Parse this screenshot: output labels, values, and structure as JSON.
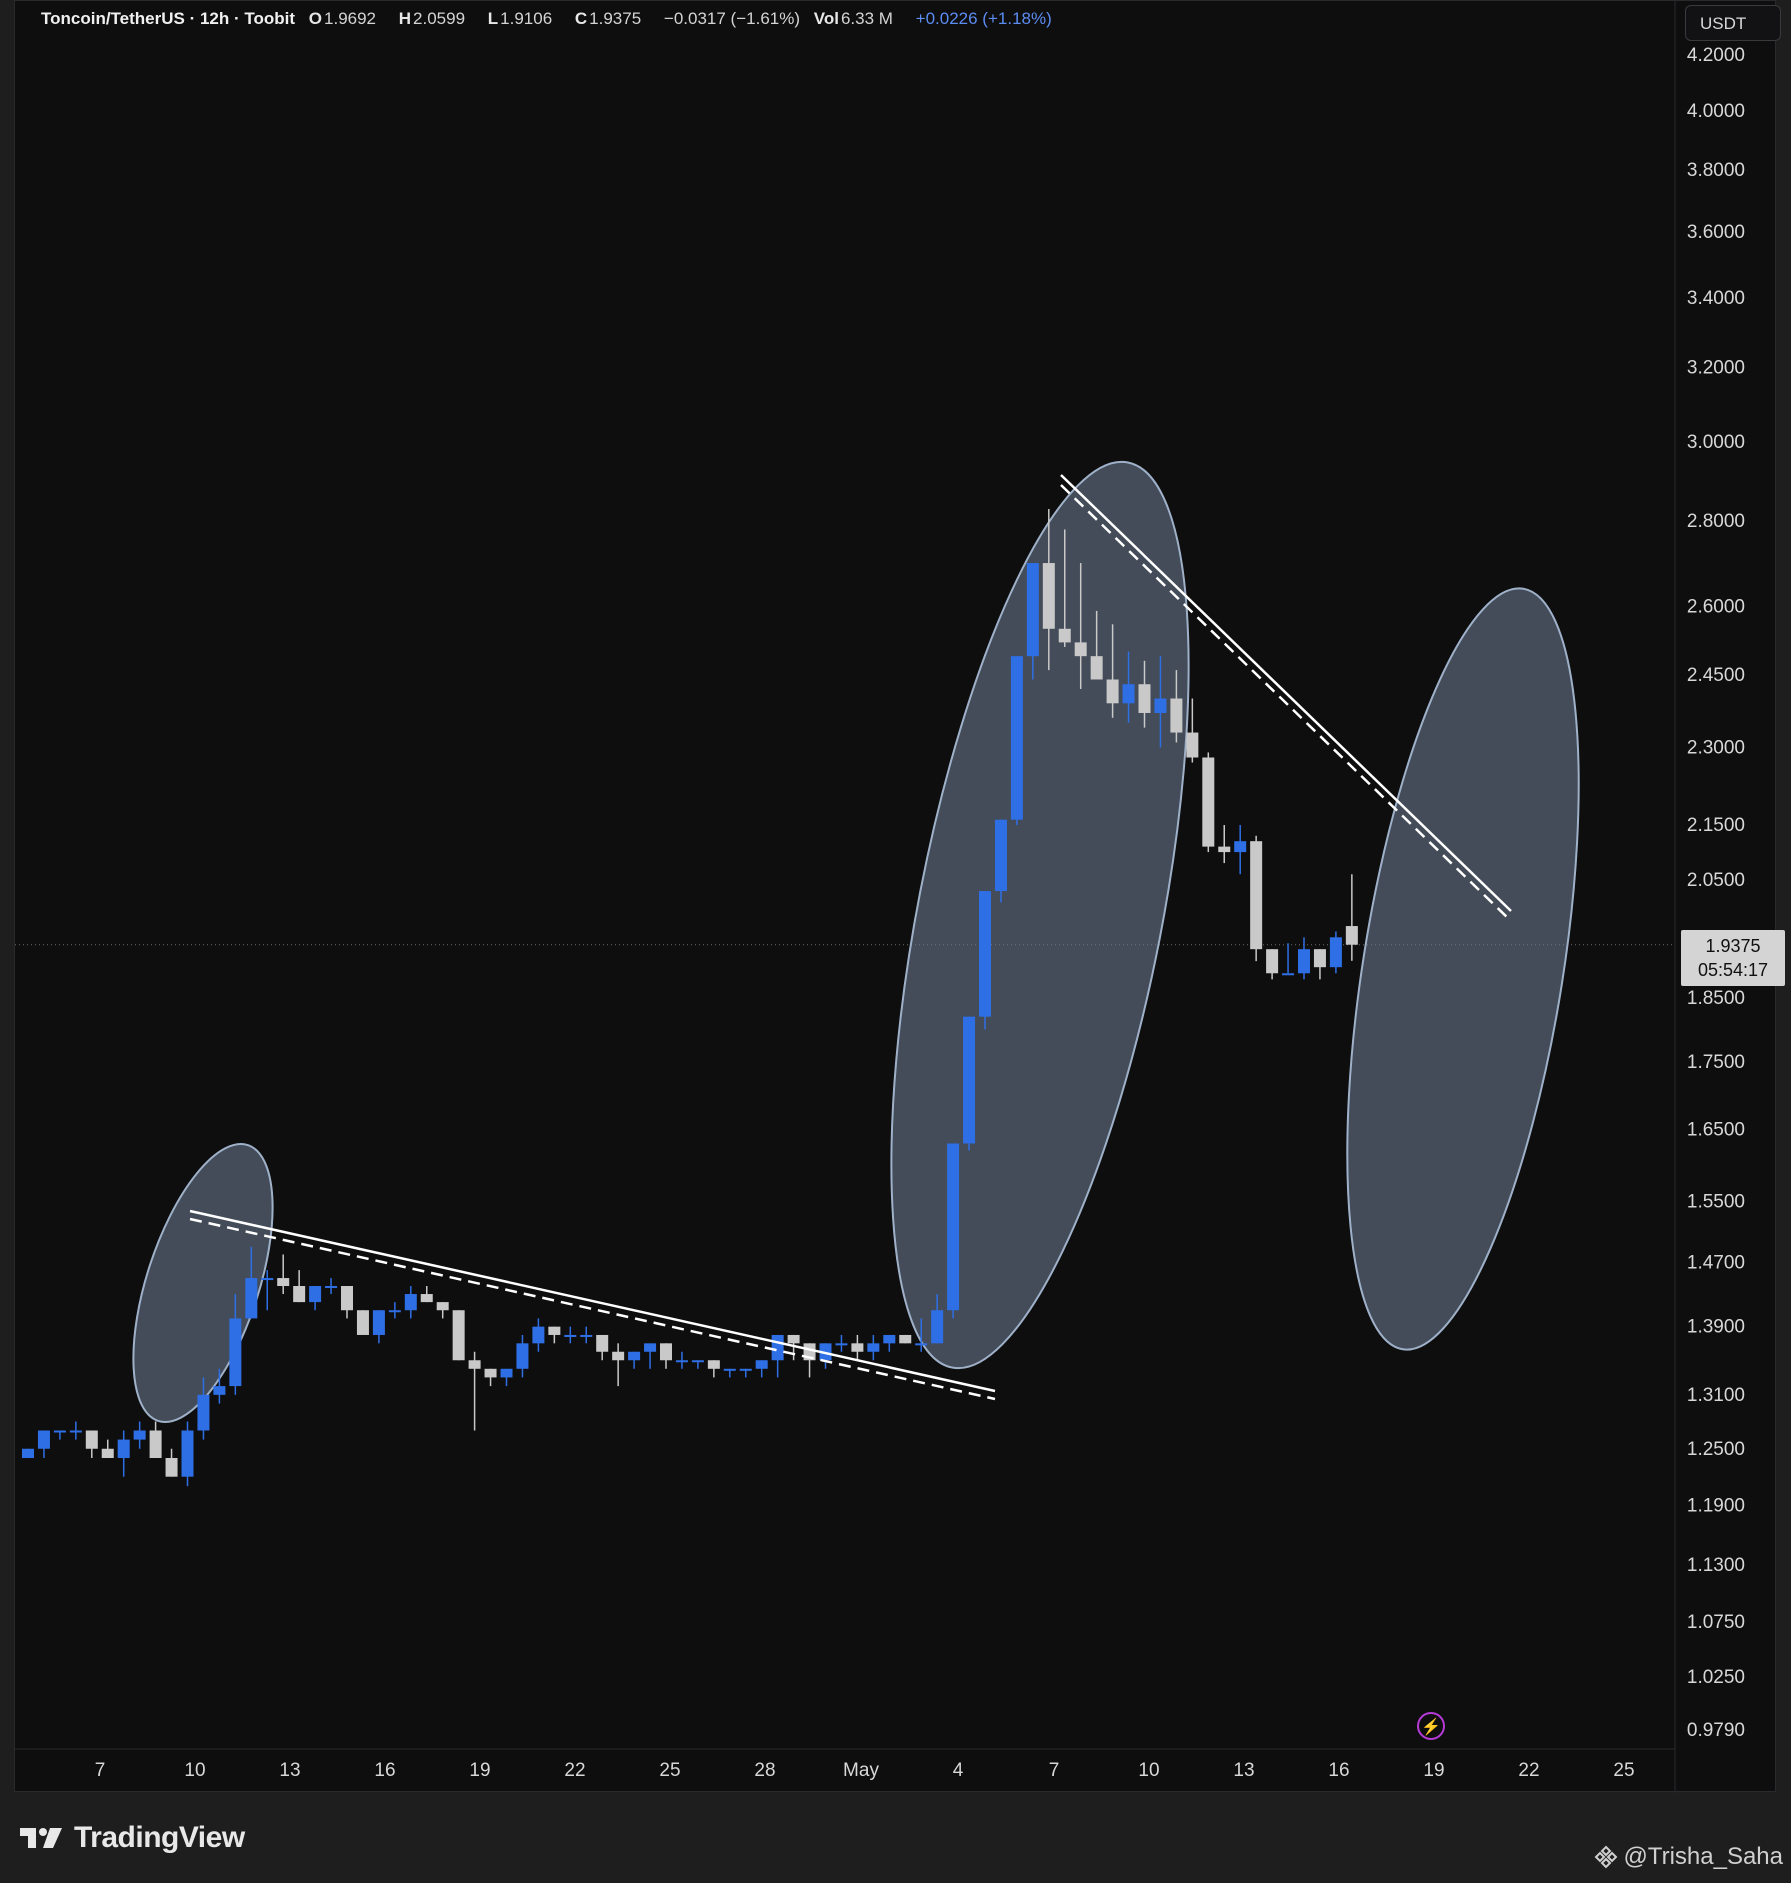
{
  "header": {
    "symbol": "Toncoin/TetherUS · 12h · Toobit",
    "open_key": "O",
    "open": "1.9692",
    "high_key": "H",
    "high": "2.0599",
    "low_key": "L",
    "low": "1.9106",
    "close_key": "C",
    "close": "1.9375",
    "change": "−0.0317 (−1.61%)",
    "vol_key": "Vol",
    "vol": "6.33 M",
    "vol_change": "+0.0226 (+1.18%)"
  },
  "currency": "USDT",
  "price_label": {
    "price": "1.9375",
    "countdown": "05:54:17"
  },
  "footer": {
    "brand": "TradingView",
    "credit": "@Trisha_Saha"
  },
  "colors": {
    "up": "#2f6fe6",
    "down": "#c9c9c9",
    "ellipse": "#6f7f96",
    "trendline": "#ffffff"
  },
  "chart_data": {
    "type": "candlestick",
    "scale": "log",
    "y_ticks": [
      "4.2000",
      "4.0000",
      "3.8000",
      "3.6000",
      "3.4000",
      "3.2000",
      "3.0000",
      "2.8000",
      "2.6000",
      "2.4500",
      "2.3000",
      "2.1500",
      "2.0500",
      "1.8500",
      "1.7500",
      "1.6500",
      "1.5500",
      "1.4700",
      "1.3900",
      "1.3100",
      "1.2500",
      "1.1900",
      "1.1300",
      "1.0750",
      "1.0250",
      "0.9790"
    ],
    "x_ticks": [
      "7",
      "10",
      "13",
      "16",
      "19",
      "22",
      "25",
      "28",
      "May",
      "4",
      "7",
      "10",
      "13",
      "16",
      "19",
      "22",
      "25"
    ],
    "candles": [
      [
        1.24,
        1.25,
        1.24,
        1.25
      ],
      [
        1.25,
        1.27,
        1.24,
        1.27
      ],
      [
        1.27,
        1.27,
        1.26,
        1.27
      ],
      [
        1.27,
        1.28,
        1.26,
        1.27
      ],
      [
        1.27,
        1.27,
        1.24,
        1.25
      ],
      [
        1.25,
        1.26,
        1.24,
        1.24
      ],
      [
        1.24,
        1.27,
        1.22,
        1.26
      ],
      [
        1.26,
        1.28,
        1.25,
        1.27
      ],
      [
        1.27,
        1.28,
        1.24,
        1.24
      ],
      [
        1.24,
        1.25,
        1.22,
        1.22
      ],
      [
        1.22,
        1.28,
        1.21,
        1.27
      ],
      [
        1.27,
        1.33,
        1.26,
        1.31
      ],
      [
        1.31,
        1.34,
        1.3,
        1.32
      ],
      [
        1.32,
        1.43,
        1.31,
        1.4
      ],
      [
        1.4,
        1.49,
        1.4,
        1.45
      ],
      [
        1.45,
        1.46,
        1.41,
        1.45
      ],
      [
        1.45,
        1.48,
        1.43,
        1.44
      ],
      [
        1.44,
        1.46,
        1.42,
        1.42
      ],
      [
        1.42,
        1.44,
        1.41,
        1.44
      ],
      [
        1.44,
        1.45,
        1.43,
        1.44
      ],
      [
        1.44,
        1.44,
        1.4,
        1.41
      ],
      [
        1.41,
        1.41,
        1.38,
        1.38
      ],
      [
        1.38,
        1.41,
        1.37,
        1.41
      ],
      [
        1.41,
        1.42,
        1.4,
        1.41
      ],
      [
        1.41,
        1.44,
        1.4,
        1.43
      ],
      [
        1.43,
        1.44,
        1.42,
        1.42
      ],
      [
        1.42,
        1.42,
        1.4,
        1.41
      ],
      [
        1.41,
        1.41,
        1.35,
        1.35
      ],
      [
        1.35,
        1.36,
        1.27,
        1.34
      ],
      [
        1.34,
        1.34,
        1.32,
        1.33
      ],
      [
        1.33,
        1.34,
        1.32,
        1.34
      ],
      [
        1.34,
        1.38,
        1.33,
        1.37
      ],
      [
        1.37,
        1.4,
        1.36,
        1.39
      ],
      [
        1.39,
        1.39,
        1.37,
        1.38
      ],
      [
        1.38,
        1.39,
        1.37,
        1.38
      ],
      [
        1.38,
        1.39,
        1.37,
        1.38
      ],
      [
        1.38,
        1.38,
        1.35,
        1.36
      ],
      [
        1.36,
        1.37,
        1.32,
        1.35
      ],
      [
        1.35,
        1.36,
        1.34,
        1.36
      ],
      [
        1.36,
        1.37,
        1.34,
        1.37
      ],
      [
        1.37,
        1.37,
        1.34,
        1.35
      ],
      [
        1.35,
        1.36,
        1.34,
        1.35
      ],
      [
        1.35,
        1.35,
        1.34,
        1.35
      ],
      [
        1.35,
        1.35,
        1.33,
        1.34
      ],
      [
        1.34,
        1.34,
        1.33,
        1.34
      ],
      [
        1.34,
        1.34,
        1.33,
        1.34
      ],
      [
        1.34,
        1.35,
        1.33,
        1.35
      ],
      [
        1.35,
        1.36,
        1.33,
        1.38
      ],
      [
        1.38,
        1.38,
        1.35,
        1.37
      ],
      [
        1.37,
        1.37,
        1.33,
        1.35
      ],
      [
        1.35,
        1.37,
        1.34,
        1.37
      ],
      [
        1.37,
        1.38,
        1.36,
        1.37
      ],
      [
        1.37,
        1.38,
        1.35,
        1.36
      ],
      [
        1.36,
        1.38,
        1.35,
        1.37
      ],
      [
        1.37,
        1.38,
        1.36,
        1.38
      ],
      [
        1.38,
        1.38,
        1.37,
        1.37
      ],
      [
        1.37,
        1.4,
        1.36,
        1.37
      ],
      [
        1.37,
        1.43,
        1.37,
        1.41
      ],
      [
        1.41,
        1.63,
        1.4,
        1.63
      ],
      [
        1.63,
        1.82,
        1.62,
        1.82
      ],
      [
        1.82,
        2.03,
        1.8,
        2.03
      ],
      [
        2.03,
        2.16,
        2.01,
        2.16
      ],
      [
        2.16,
        2.4,
        2.15,
        2.49
      ],
      [
        2.49,
        2.62,
        2.44,
        2.7
      ],
      [
        2.7,
        2.83,
        2.46,
        2.55
      ],
      [
        2.55,
        2.78,
        2.51,
        2.52
      ],
      [
        2.52,
        2.7,
        2.42,
        2.49
      ],
      [
        2.49,
        2.59,
        2.46,
        2.44
      ],
      [
        2.44,
        2.56,
        2.36,
        2.39
      ],
      [
        2.39,
        2.5,
        2.35,
        2.43
      ],
      [
        2.43,
        2.48,
        2.34,
        2.37
      ],
      [
        2.37,
        2.49,
        2.3,
        2.4
      ],
      [
        2.4,
        2.46,
        2.31,
        2.33
      ],
      [
        2.33,
        2.4,
        2.27,
        2.28
      ],
      [
        2.28,
        2.29,
        2.1,
        2.11
      ],
      [
        2.11,
        2.15,
        2.08,
        2.1
      ],
      [
        2.1,
        2.15,
        2.06,
        2.12
      ],
      [
        2.12,
        2.13,
        1.91,
        1.93
      ],
      [
        1.93,
        1.93,
        1.88,
        1.89
      ],
      [
        1.89,
        1.94,
        1.89,
        1.89
      ],
      [
        1.89,
        1.95,
        1.88,
        1.93
      ],
      [
        1.93,
        1.93,
        1.88,
        1.9
      ],
      [
        1.9,
        1.96,
        1.89,
        1.95
      ],
      [
        1.9692,
        2.0599,
        1.9106,
        1.9375
      ]
    ],
    "annotations": [
      "ellipse around rally near 10",
      "descending dashed trendline 10 → 4",
      "ellipse around rally 4 → 7",
      "descending dashed trendline 7 → 19",
      "projected ellipse 19 → 21"
    ]
  }
}
